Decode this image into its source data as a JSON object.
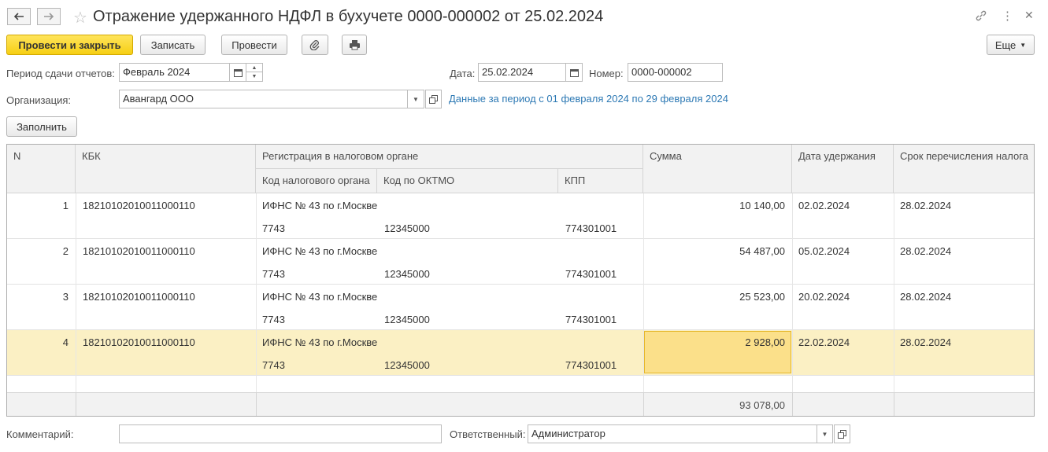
{
  "window": {
    "title": "Отражение удержанного НДФЛ в бухучете 0000-000002 от 25.02.2024"
  },
  "toolbar": {
    "post_close": "Провести и закрыть",
    "save": "Записать",
    "post": "Провести",
    "more": "Еще"
  },
  "header": {
    "period_label": "Период сдачи отчетов:",
    "period_value": "Февраль 2024",
    "date_label": "Дата:",
    "date_value": "25.02.2024",
    "number_label": "Номер:",
    "number_value": "0000-000002",
    "org_label": "Организация:",
    "org_value": "Авангард ООО",
    "period_link": "Данные за период с 01 февраля 2024 по 29 февраля 2024",
    "fill_button": "Заполнить"
  },
  "table": {
    "headers": {
      "n": "N",
      "kbk": "КБК",
      "registration": "Регистрация в налоговом органе",
      "tax_code": "Код налогового органа",
      "oktmo": "Код по ОКТМО",
      "kpp": "КПП",
      "sum": "Сумма",
      "withhold_date": "Дата удержания",
      "transfer_due": "Срок перечисления налога"
    },
    "rows": [
      {
        "n": "1",
        "kbk": "18210102010011000110",
        "registration": "ИФНС № 43 по г.Москве",
        "tax_code": "7743",
        "oktmo": "12345000",
        "kpp": "774301001",
        "sum": "10 140,00",
        "withhold_date": "02.02.2024",
        "transfer_due": "28.02.2024"
      },
      {
        "n": "2",
        "kbk": "18210102010011000110",
        "registration": "ИФНС № 43 по г.Москве",
        "tax_code": "7743",
        "oktmo": "12345000",
        "kpp": "774301001",
        "sum": "54 487,00",
        "withhold_date": "05.02.2024",
        "transfer_due": "28.02.2024"
      },
      {
        "n": "3",
        "kbk": "18210102010011000110",
        "registration": "ИФНС № 43 по г.Москве",
        "tax_code": "7743",
        "oktmo": "12345000",
        "kpp": "774301001",
        "sum": "25 523,00",
        "withhold_date": "20.02.2024",
        "transfer_due": "28.02.2024"
      },
      {
        "n": "4",
        "kbk": "18210102010011000110",
        "registration": "ИФНС № 43 по г.Москве",
        "tax_code": "7743",
        "oktmo": "12345000",
        "kpp": "774301001",
        "sum": "2 928,00",
        "withhold_date": "22.02.2024",
        "transfer_due": "28.02.2024"
      }
    ],
    "total_sum": "93 078,00"
  },
  "footer": {
    "comment_label": "Комментарий:",
    "comment_value": "",
    "responsible_label": "Ответственный:",
    "responsible_value": "Администратор"
  }
}
